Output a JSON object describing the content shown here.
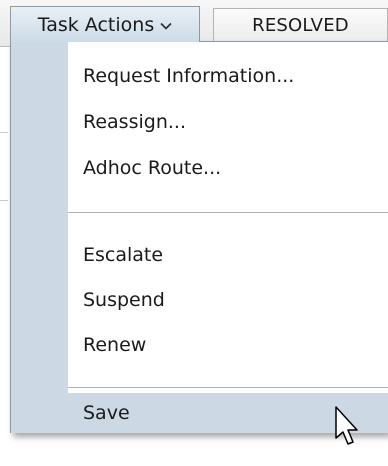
{
  "toolbar": {
    "task_actions_label": "Task Actions",
    "resolved_label": "RESOLVED"
  },
  "menu": {
    "items": [
      {
        "label": "Request Information..."
      },
      {
        "label": "Reassign..."
      },
      {
        "label": "Adhoc Route..."
      },
      {
        "label": "Escalate"
      },
      {
        "label": "Suspend"
      },
      {
        "label": "Renew"
      },
      {
        "label": "Save"
      }
    ],
    "highlighted": "Save"
  },
  "icons": {
    "dropdown": "chevron-down-icon",
    "pointer": "mouse-pointer-icon"
  },
  "colors": {
    "gutter": "#ccd9e5",
    "button_top": "#e9f0f6",
    "button_bottom": "#ccdbe7",
    "border": "#8a9aa8"
  }
}
